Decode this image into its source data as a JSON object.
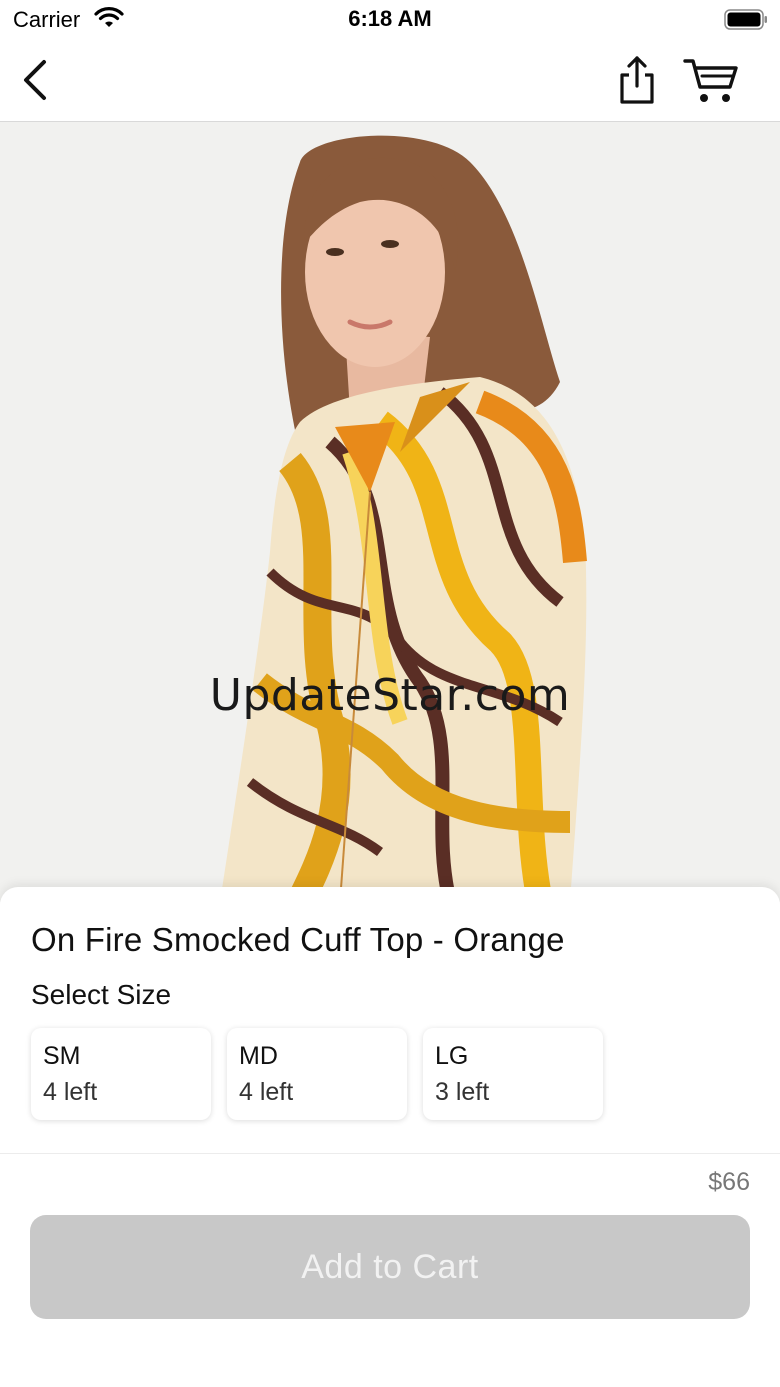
{
  "status_bar": {
    "carrier": "Carrier",
    "time": "6:18 AM",
    "icons": [
      "wifi-icon",
      "battery-icon"
    ]
  },
  "nav": {
    "back_icon": "chevron-left-icon",
    "share_icon": "share-icon",
    "cart_icon": "cart-icon"
  },
  "product": {
    "image_watermark": "UpdateStar.com",
    "title": "On Fire Smocked Cuff Top - Orange",
    "size_label": "Select Size",
    "sizes": [
      {
        "name": "SM",
        "stock": "4 left"
      },
      {
        "name": "MD",
        "stock": "4 left"
      },
      {
        "name": "LG",
        "stock": "3 left"
      }
    ],
    "price": "$66",
    "add_to_cart_label": "Add to Cart"
  },
  "colors": {
    "disabled_button": "#c8c8c8",
    "button_text": "#f2f2f2",
    "price_text": "#777777"
  }
}
